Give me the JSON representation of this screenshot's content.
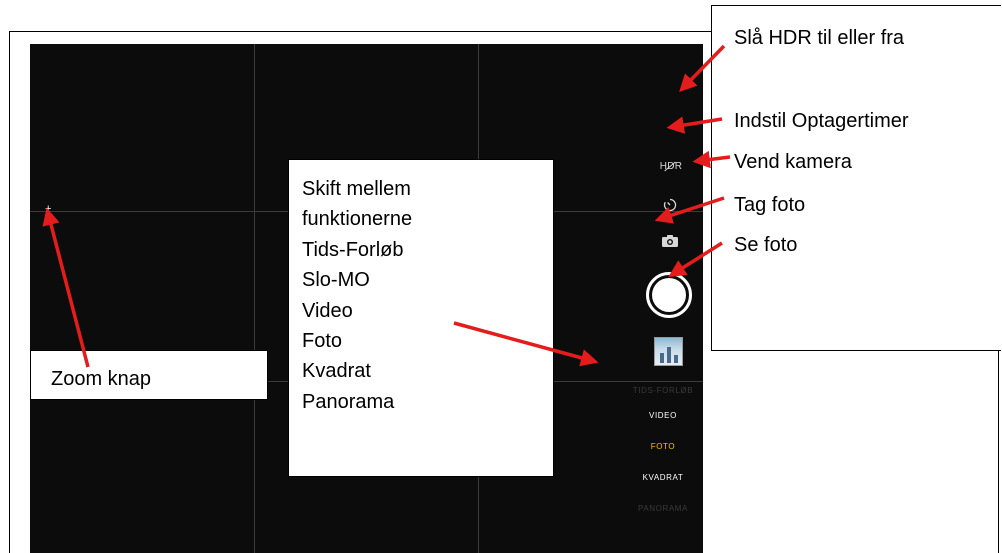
{
  "camera": {
    "hdr_label": "HDR",
    "modes": [
      {
        "label": "TIDS-FORLØB",
        "state": "dim"
      },
      {
        "label": "VIDEO",
        "state": "normal"
      },
      {
        "label": "FOTO",
        "state": "active"
      },
      {
        "label": "KVADRAT",
        "state": "normal"
      },
      {
        "label": "PANORAMA",
        "state": "dim"
      }
    ],
    "active_mode_color": "#f2c300",
    "icons": {
      "timer": "timer-icon",
      "flip": "camera-flip-icon",
      "zoom": "plus-icon"
    }
  },
  "callouts": {
    "modes_box": {
      "lines": [
        "Skift mellem",
        "funktionerne",
        "Tids-Forløb",
        "Slo-MO",
        "Video",
        "Foto",
        "Kvadrat",
        "Panorama"
      ]
    },
    "zoom_box": {
      "label": "Zoom knap"
    },
    "right_box": {
      "hdr": "Slå HDR til eller fra",
      "timer": "Indstil Optagertimer",
      "flip": "Vend kamera",
      "take_photo": "Tag foto",
      "view_photo": "Se foto"
    }
  },
  "annotation_color": "#e51c1c"
}
